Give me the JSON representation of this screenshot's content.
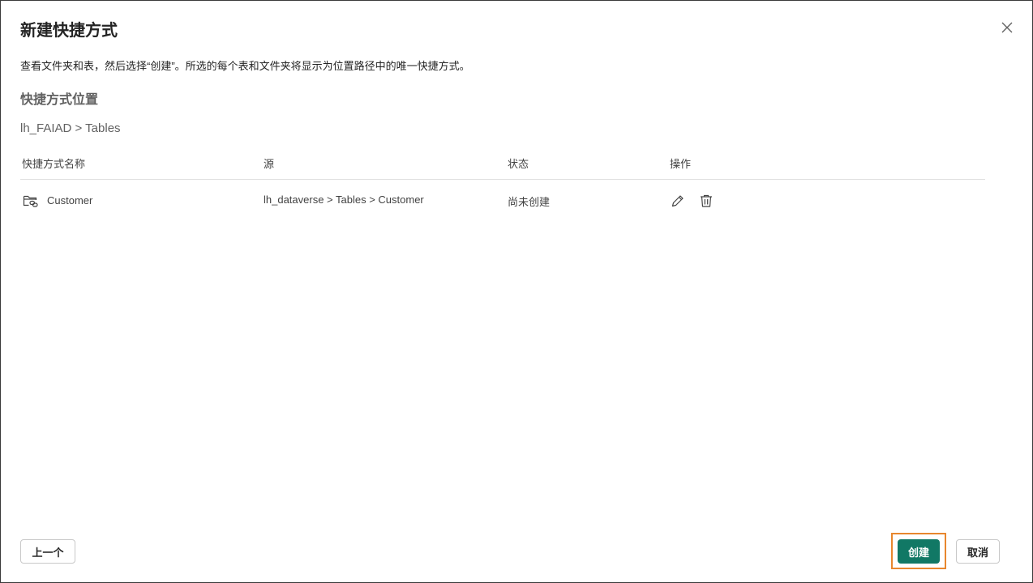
{
  "dialog": {
    "title": "新建快捷方式",
    "description": "查看文件夹和表，然后选择“创建”。所选的每个表和文件夹将显示为位置路径中的唯一快捷方式。",
    "section_title": "快捷方式位置",
    "location_breadcrumb": "lh_FAIAD > Tables"
  },
  "table": {
    "headers": {
      "name": "快捷方式名称",
      "source": "源",
      "status": "状态",
      "actions": "操作"
    },
    "rows": [
      {
        "name": "Customer",
        "source": "lh_dataverse > Tables > Customer",
        "status": "尚未创建",
        "icon": "folder-link-icon"
      }
    ]
  },
  "footer": {
    "prev_label": "上一个",
    "create_label": "创建",
    "cancel_label": "取消"
  },
  "colors": {
    "primary": "#117865",
    "highlight": "#e8872e"
  }
}
